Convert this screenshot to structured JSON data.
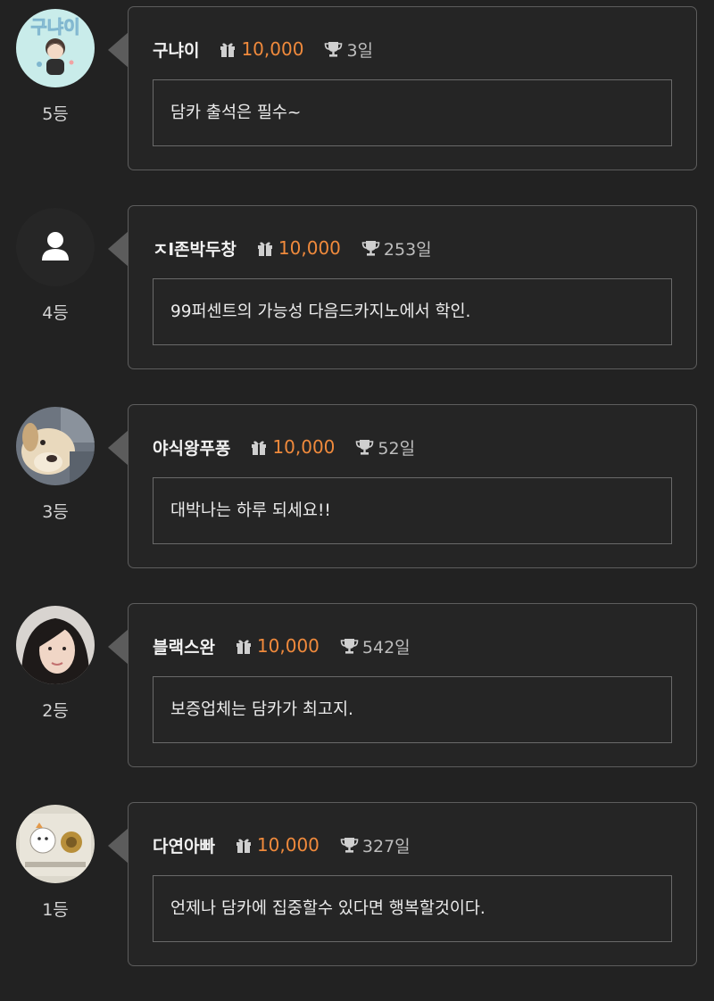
{
  "entries": [
    {
      "rank": "5등",
      "nickname": "구냐이",
      "points": "10,000",
      "days": "3일",
      "message": "담카 출석은 필수~",
      "avatar": "character-avatar-icon",
      "avatar_text": "구냐이"
    },
    {
      "rank": "4등",
      "nickname": "ㅈl존박두창",
      "points": "10,000",
      "days": "253일",
      "message": "99퍼센트의 가능성 다음드카지노에서 학인.",
      "avatar": "default-user-icon"
    },
    {
      "rank": "3등",
      "nickname": "야식왕푸퐁",
      "points": "10,000",
      "days": "52일",
      "message": "대박나는 하루 되세요!!",
      "avatar": "dog-photo-avatar"
    },
    {
      "rank": "2등",
      "nickname": "블랙스완",
      "points": "10,000",
      "days": "542일",
      "message": "보증업체는 담카가 최고지.",
      "avatar": "woman-photo-avatar"
    },
    {
      "rank": "1등",
      "nickname": "다연아빠",
      "points": "10,000",
      "days": "327일",
      "message": "언제나 담카에 집중할수 있다면 행복할것이다.",
      "avatar": "cartoon-photo-avatar"
    }
  ],
  "icons": {
    "points": "gift-icon",
    "days": "trophy-icon"
  },
  "colors": {
    "background": "#222222",
    "points": "#f08a3c",
    "border": "#5d5d5d"
  }
}
